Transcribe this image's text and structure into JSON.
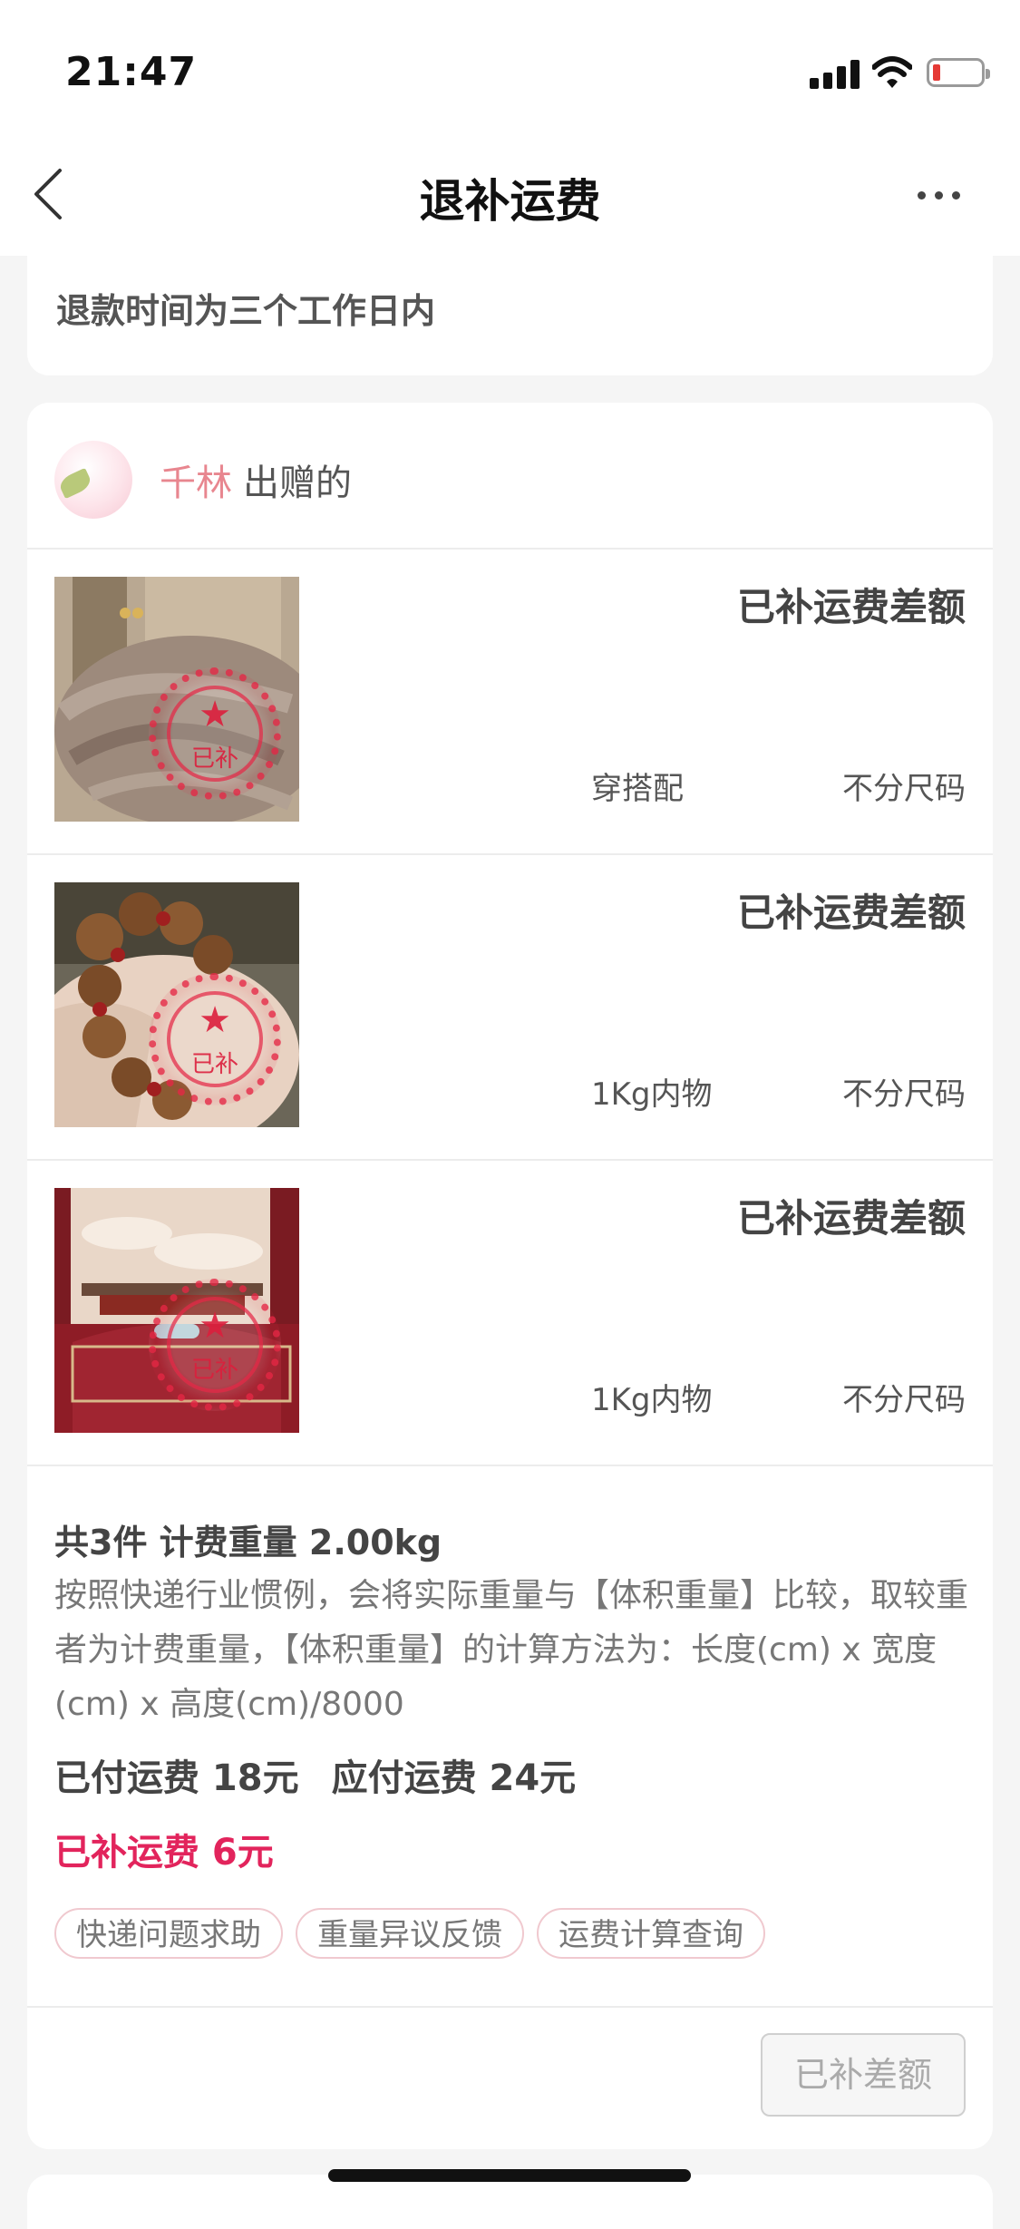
{
  "status_bar": {
    "time": "21:47"
  },
  "nav": {
    "title": "退补运费"
  },
  "notice": {
    "text": "退款时间为三个工作日内"
  },
  "seller": {
    "name": "千林",
    "suffix": "出赠的"
  },
  "items": [
    {
      "status": "已补运费差额",
      "category": "穿搭配",
      "size": "不分尺码"
    },
    {
      "status": "已补运费差额",
      "category": "1Kg内物",
      "size": "不分尺码"
    },
    {
      "status": "已补运费差额",
      "category": "1Kg内物",
      "size": "不分尺码"
    }
  ],
  "stamp": {
    "text": "已补"
  },
  "summary": {
    "title": "共3件 计费重量 2.00kg",
    "note": "按照快递行业惯例，会将实际重量与【体积重量】比较，取较重者为计费重量，【体积重量】的计算方法为：长度(cm) x 宽度(cm) x 高度(cm)/8000",
    "paid": "已付运费 18元",
    "due": "应付运费 24元",
    "refunded": "已补运费 6元"
  },
  "chips": [
    "快递问题求助",
    "重量异议反馈",
    "运费计算查询"
  ],
  "action": {
    "label": "已补差额"
  },
  "colors": {
    "accent": "#e2245c",
    "seller_name": "#e8868f",
    "stamp": "#e42846"
  }
}
